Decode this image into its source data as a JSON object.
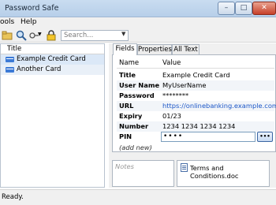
{
  "window": {
    "title": "Password Safe"
  },
  "menu": {
    "items": [
      "ools",
      "Help"
    ]
  },
  "toolbar": {
    "search_placeholder": "Search...",
    "icons": [
      "folder-icon",
      "search-icon",
      "filter-icon",
      "lock-icon"
    ]
  },
  "list": {
    "header": "Title",
    "items": [
      "Example Credit Card",
      "Another Card"
    ]
  },
  "tabs": [
    "Fields",
    "Properties",
    "All Text"
  ],
  "fields": {
    "headers": [
      "Name",
      "Value"
    ],
    "rows": [
      {
        "name": "Title",
        "value": "Example Credit Card"
      },
      {
        "name": "User Name",
        "value": "MyUserName"
      },
      {
        "name": "Password",
        "value": "********"
      },
      {
        "name": "URL",
        "value": "https://onlinebanking.example.com"
      },
      {
        "name": "Expiry",
        "value": "01/23"
      },
      {
        "name": "Number",
        "value": "1234 1234 1234 1234"
      },
      {
        "name": "PIN",
        "value": "••••"
      }
    ],
    "add_new": "(add new)",
    "pin_button": "•••"
  },
  "notes": {
    "placeholder": "Notes"
  },
  "attachments": {
    "file": "Terms and Conditions.doc"
  },
  "status": {
    "text": "Ready."
  },
  "colors": {
    "accent": "#1a55c7",
    "selection": "#dbe8f7"
  }
}
